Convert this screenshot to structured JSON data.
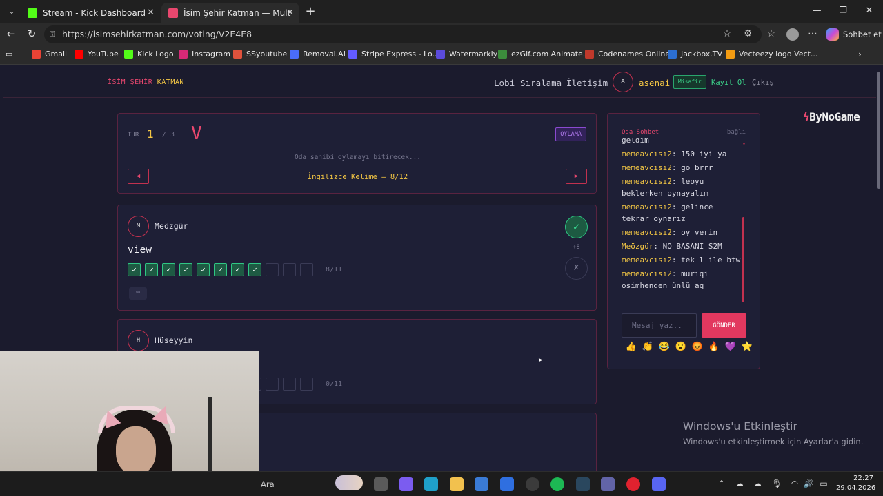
{
  "browser": {
    "tabs": [
      {
        "title": "Stream - Kick Dashboard",
        "active": false,
        "icon": "kick-icon"
      },
      {
        "title": "İsim Şehir Katman — Multiplayer K",
        "active": true,
        "icon": "site-icon"
      }
    ],
    "url": "https://isimsehirkatman.com/voting/V2E4E8",
    "copilot_label": "Sohbet et",
    "bookmarks": [
      {
        "label": "Gmail",
        "color": "#ea4335"
      },
      {
        "label": "YouTube",
        "color": "#ff0000"
      },
      {
        "label": "Kick Logo",
        "color": "#53fc18"
      },
      {
        "label": "Instagram",
        "color": "#d62976"
      },
      {
        "label": "SSyoutube",
        "color": "#e0523c"
      },
      {
        "label": "Removal.AI",
        "color": "#4a6cf7"
      },
      {
        "label": "Stripe Express - Lo...",
        "color": "#635bff"
      },
      {
        "label": "Watermarkly",
        "color": "#5b4bdb"
      },
      {
        "label": "ezGif.com Animate...",
        "color": "#3c8c3c"
      },
      {
        "label": "Codenames Online",
        "color": "#c0392b"
      },
      {
        "label": "Jackbox.TV",
        "color": "#2c6fd1"
      },
      {
        "label": "Vecteezy logo Vect...",
        "color": "#f39c12"
      }
    ]
  },
  "site": {
    "logo": {
      "part1": "İSİM",
      "part2": "ŞEHİR",
      "part3": "KATMAN"
    },
    "nav": [
      "Lobi",
      "Sıralama",
      "İletişim"
    ],
    "user": {
      "initial": "A",
      "name": "asenai",
      "badge": "Misafir"
    },
    "register": "Kayıt Ol",
    "logout": "Çıkış"
  },
  "round": {
    "label": "TUR",
    "current": "1",
    "total": "/ 3",
    "letter": "V",
    "badge": "OYLAMA",
    "host_message": "Oda sahibi oylamayı bitirecek...",
    "prev": "◀",
    "next": "▶",
    "category": "İngilizce Kelime — 8/12"
  },
  "answers": [
    {
      "initial": "M",
      "name": "Meözgür",
      "answer": "view",
      "votes_on": 8,
      "votes_total": 11,
      "count": "8/11",
      "score": "+8",
      "approve": "✓",
      "reject": "✗"
    },
    {
      "initial": "H",
      "name": "Hüseyyin",
      "answer": "",
      "votes_on": 0,
      "votes_total": 11,
      "count": "0/11"
    }
  ],
  "chat": {
    "title": "Oda Sohbet",
    "status": "bağlı",
    "messages": [
      {
        "who": "",
        "text": "geldim"
      },
      {
        "who": "memeavcısı2",
        "text": "150 iyi ya"
      },
      {
        "who": "memeavcısı2",
        "text": "go brrr"
      },
      {
        "who": "memeavcısı2",
        "text": "leoyu beklerken oynayalım"
      },
      {
        "who": "memeavcısı2",
        "text": "gelince tekrar oynarız"
      },
      {
        "who": "memeavcısı2",
        "text": "oy verin"
      },
      {
        "who": "Meözgür",
        "text": "NO BASANI S2M"
      },
      {
        "who": "memeavcısı2",
        "text": "tek l ile btw"
      },
      {
        "who": "memeavcısı2",
        "text": "muriqi osimhenden ünlü aq"
      }
    ],
    "input_placeholder": "Mesaj yaz..",
    "send": "GÖNDER",
    "emojis": [
      "👍",
      "👏",
      "😂",
      "😮",
      "😡",
      "🔥",
      "💜",
      "⭐"
    ]
  },
  "sponsor": {
    "mark": "ϟ",
    "name": "ByNoGame"
  },
  "watermark": {
    "title": "Windows'u Etkinleştir",
    "subtitle": "Windows'u etkinleştirmek için Ayarlar'a gidin."
  },
  "taskbar": {
    "search": "Ara",
    "time": "22:27",
    "date": "29.04.2026",
    "apps": [
      {
        "name": "task-view-icon",
        "color": "#5a5a5a"
      },
      {
        "name": "copilot-app-icon",
        "color": "#7b5cf0"
      },
      {
        "name": "edge-icon",
        "color": "#1fa0c9"
      },
      {
        "name": "file-explorer-icon",
        "color": "#f2c14e"
      },
      {
        "name": "store-icon",
        "color": "#3a7bd5"
      },
      {
        "name": "mail-icon",
        "color": "#2f6fe0"
      },
      {
        "name": "obs-icon",
        "color": "#3b3b3b"
      },
      {
        "name": "spotify-icon",
        "color": "#1db954"
      },
      {
        "name": "steam-icon",
        "color": "#2a475e"
      },
      {
        "name": "teams-icon",
        "color": "#6264a7"
      },
      {
        "name": "opera-icon",
        "color": "#e0222f"
      },
      {
        "name": "discord-icon",
        "color": "#5865f2"
      }
    ]
  }
}
